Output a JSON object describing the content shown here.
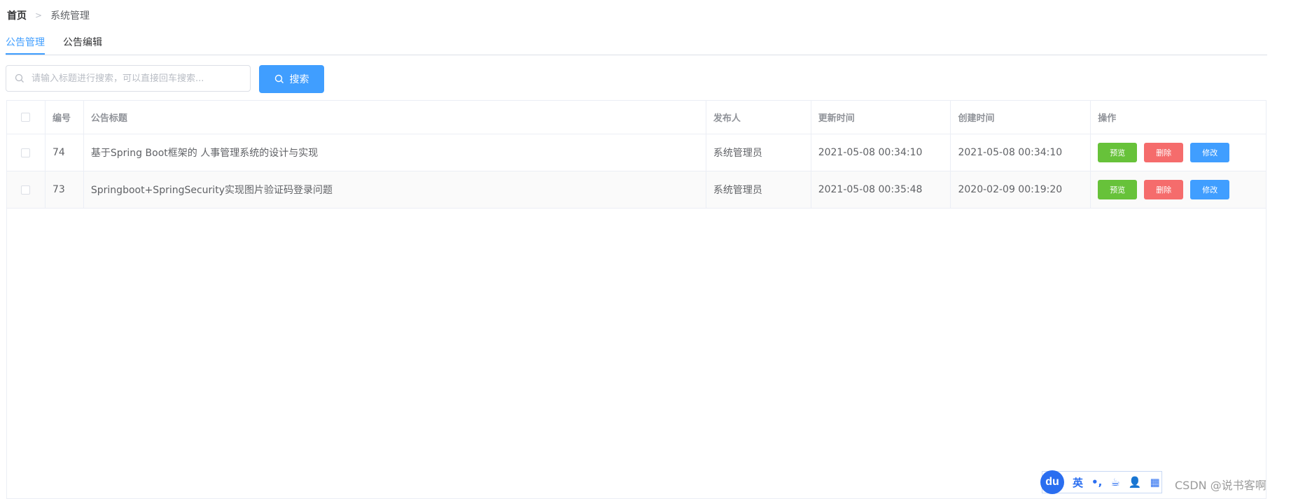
{
  "breadcrumb": {
    "home": "首页",
    "separator": ">",
    "current": "系统管理"
  },
  "tabs": [
    {
      "label": "公告管理",
      "active": true
    },
    {
      "label": "公告编辑",
      "active": false
    }
  ],
  "search": {
    "placeholder": "请输入标题进行搜索，可以直接回车搜索...",
    "value": "",
    "button_label": "搜索"
  },
  "table": {
    "columns": {
      "id": "编号",
      "title": "公告标题",
      "publisher": "发布人",
      "updated": "更新时间",
      "created": "创建时间",
      "actions": "操作"
    },
    "rows": [
      {
        "id": "74",
        "title": "基于Spring Boot框架的 人事管理系统的设计与实现",
        "publisher": "系统管理员",
        "updated": "2021-05-08 00:34:10",
        "created": "2021-05-08 00:34:10"
      },
      {
        "id": "73",
        "title": "Springboot+SpringSecurity实现图片验证码登录问题",
        "publisher": "系统管理员",
        "updated": "2021-05-08 00:35:48",
        "created": "2020-02-09 00:19:20"
      }
    ],
    "actions": {
      "preview": "预览",
      "delete": "删除",
      "edit": "修改"
    }
  },
  "ime_toolbar": {
    "logo": "du",
    "items": [
      "英",
      "•,",
      "☕",
      "👤",
      "▦"
    ]
  },
  "watermark": "CSDN @说书客啊",
  "colors": {
    "primary": "#409eff",
    "success": "#67c23a",
    "danger": "#f56c6c",
    "border": "#ebeef5"
  }
}
